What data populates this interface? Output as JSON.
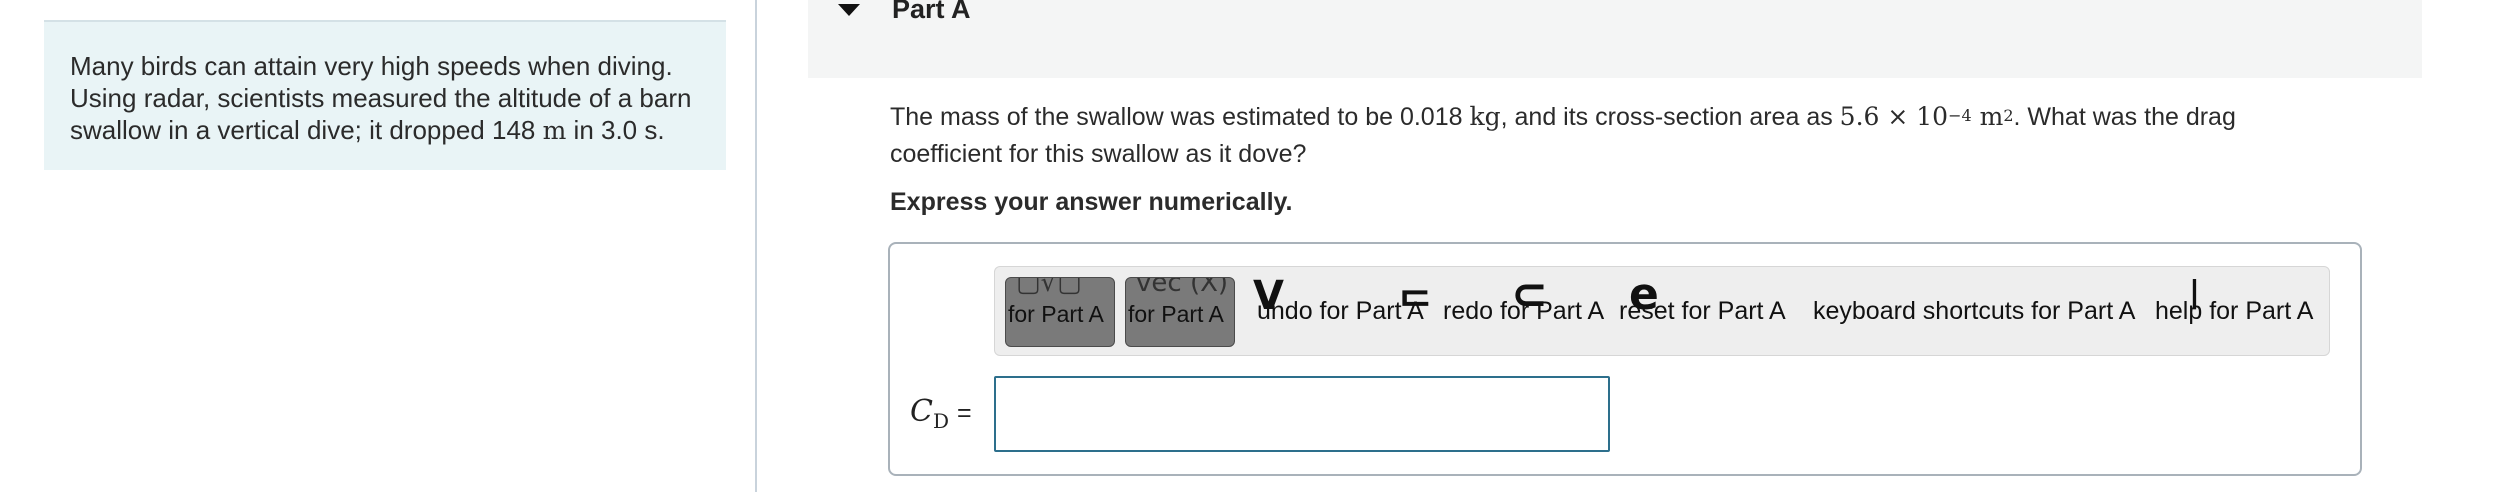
{
  "intro": {
    "line1": "Many birds can attain very high speeds when diving.",
    "line2": "Using radar, scientists measured the altitude of a barn",
    "line3_pre": "swallow in a vertical dive; it dropped 148 ",
    "line3_unit": "m",
    "line3_post": " in 3.0 s."
  },
  "part": {
    "title": "Part A"
  },
  "question": {
    "pre": "The mass of the swallow was estimated to be 0.018 ",
    "mass_unit": "kg",
    "mid": ", and its cross-section area as ",
    "area_value": "5.6 × 10",
    "area_exp": "−4",
    "area_unit": " m",
    "area_unit_exp": "2",
    "post": ". What was the drag coefficient for this swallow as it dove?"
  },
  "instruction": "Express your answer numerically.",
  "toolbar": {
    "templates_label": "for Part A",
    "symbols_label": "for Part A",
    "undo_label": "undo for Part A",
    "redo_label": "redo for Part A",
    "reset_label": "reset for Part A",
    "shortcuts_label": "keyboard shortcuts for Part A",
    "help_label": "help for Part A"
  },
  "answer": {
    "symbol": "C",
    "subscript": "D",
    "equals": "=",
    "value": ""
  }
}
